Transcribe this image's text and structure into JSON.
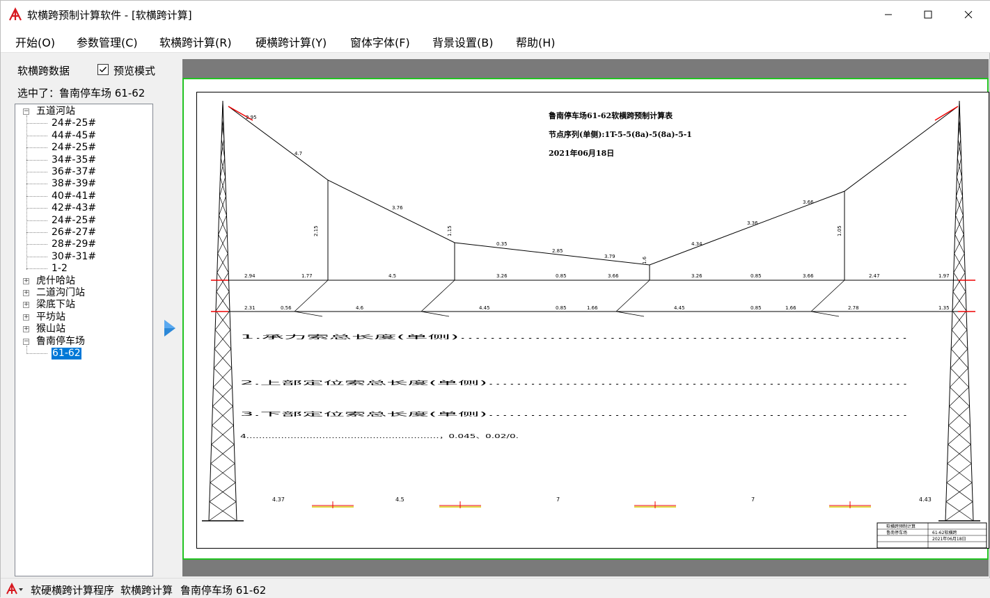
{
  "window": {
    "title": "软横跨预制计算软件 - [软横跨计算]"
  },
  "menu": [
    "开始(O)",
    "参数管理(C)",
    "软横跨计算(R)",
    "硬横跨计算(Y)",
    "窗体字体(F)",
    "背景设置(B)",
    "帮助(H)"
  ],
  "left_panel": {
    "title": "软横跨数据",
    "preview_label": "预览模式",
    "preview_checked": true,
    "selected_text": "选中了：鲁南停车场 61-62"
  },
  "tree": {
    "stations": [
      {
        "name": "五道河站",
        "expanded": true,
        "children": [
          "24#-25#",
          "44#-45#",
          "24#-25#",
          "34#-35#",
          "36#-37#",
          "38#-39#",
          "40#-41#",
          "42#-43#",
          "24#-25#",
          "26#-27#",
          "28#-29#",
          "30#-31#",
          "1-2"
        ]
      },
      {
        "name": "虎什哈站",
        "expanded": false,
        "children": []
      },
      {
        "name": "二道沟门站",
        "expanded": false,
        "children": []
      },
      {
        "name": "梁底下站",
        "expanded": false,
        "children": []
      },
      {
        "name": "平坊站",
        "expanded": false,
        "children": []
      },
      {
        "name": "猴山站",
        "expanded": false,
        "children": []
      },
      {
        "name": "鲁南停车场",
        "expanded": true,
        "children": [
          "61-62"
        ]
      }
    ],
    "selected": "61-62"
  },
  "drawing": {
    "title_lines": [
      "鲁南停车场61-62软横跨预制计算表",
      "节点序列(单侧):1T-5-5(8a)-5(8a)-5-1",
      "2021年06月18日"
    ],
    "upper_labels": [
      "2.94",
      "1.77",
      "4.5",
      "3.26",
      "0.85",
      "3.66",
      "3.26",
      "0.85",
      "3.66",
      "2.47",
      "1.97"
    ],
    "lower_labels": [
      "2.31",
      "0.56",
      "4.6",
      "4.45",
      "0.85",
      "1.66",
      "4.45",
      "0.85",
      "1.66",
      "2.78",
      "1.35"
    ],
    "cable_labels": [
      "2.95",
      "4.7",
      "3.76",
      "0.35",
      "2.85",
      "3.79",
      "4.34",
      "3.36",
      "3.66"
    ],
    "drop_labels": [
      "2.15",
      "1.15",
      "1.6",
      "1.05"
    ],
    "bottom_dims": [
      "4.37",
      "4.5",
      "7",
      "7",
      "4.43"
    ],
    "notes": [
      "1.承力索总长度(单侧)……………………………………………………",
      "2.上部定位索总长度(单侧)……………………………………………………",
      "3.下部定位索总长度(单侧)……………………………………………………",
      "4.……………………………………………………，0.045、0.02/0."
    ],
    "title_block": [
      "软横跨预制计算",
      "鲁南停车场",
      "61-62软横跨",
      "2021年06月18日"
    ]
  },
  "statusbar": {
    "program": "软硬横跨计算程序",
    "module": "软横跨计算",
    "location": "鲁南停车场 61-62"
  }
}
